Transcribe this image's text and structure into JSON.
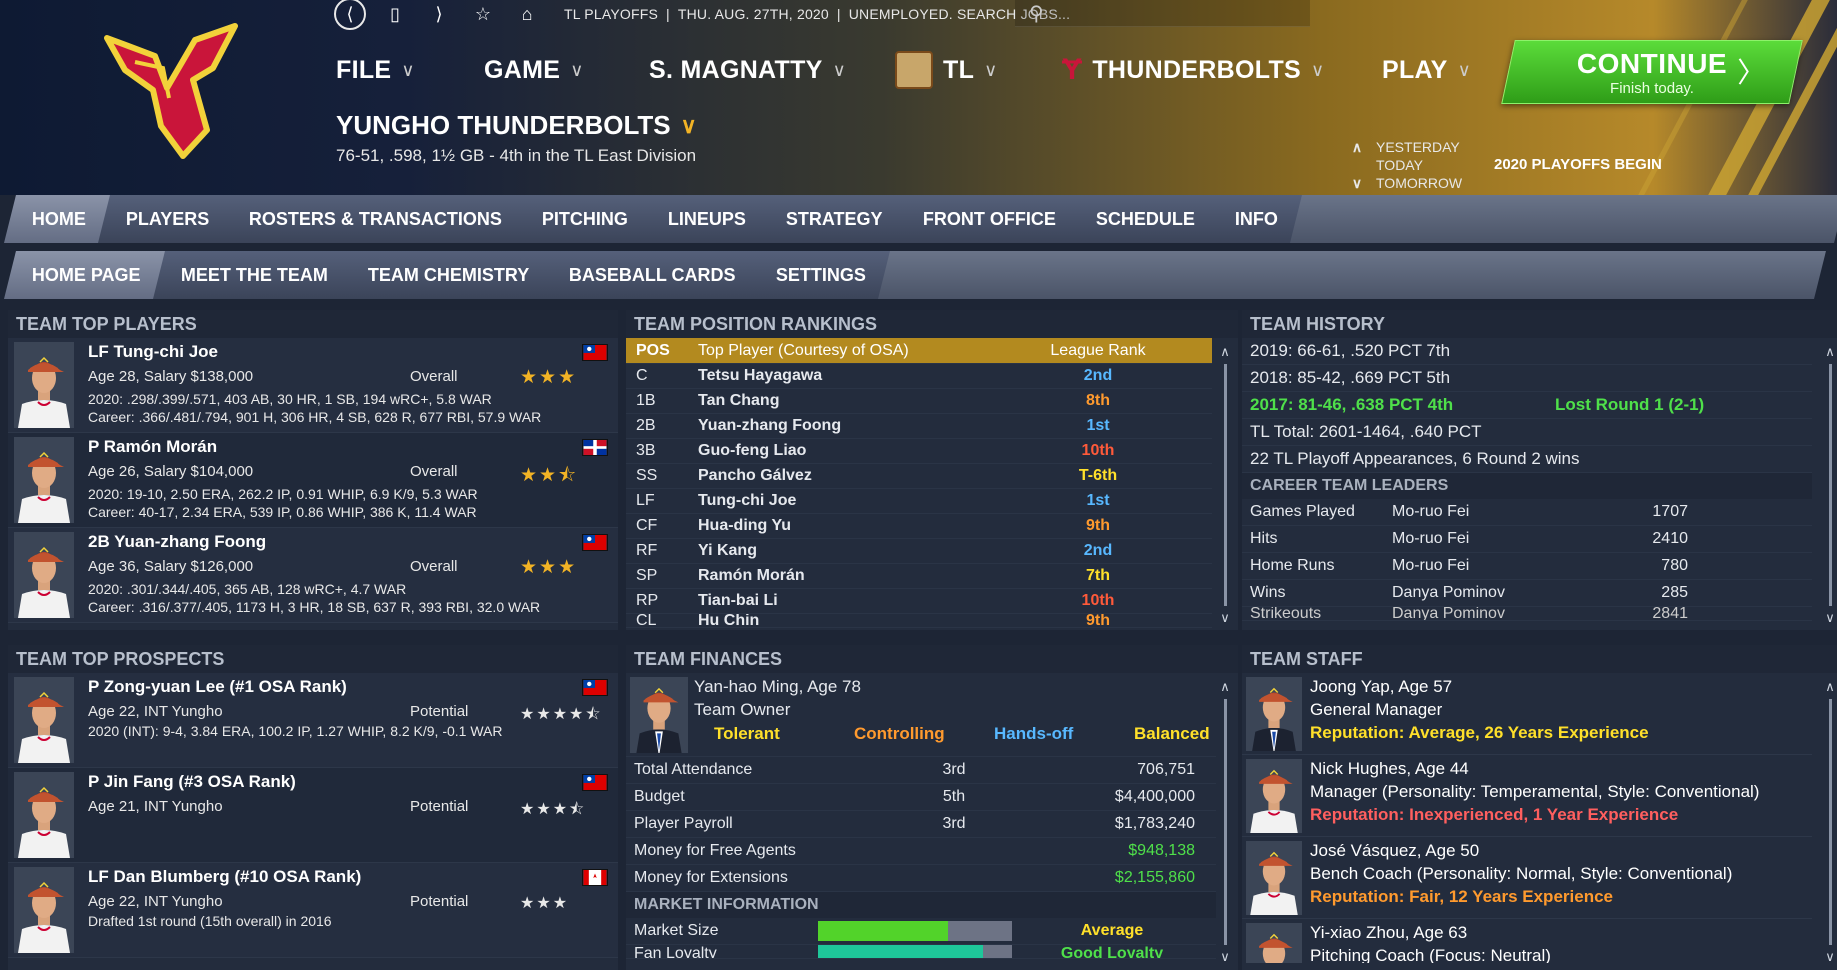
{
  "colors": {
    "accent": "#f2b325",
    "continue": "#3fbf22",
    "rank_blue": "#58b8ff",
    "rank_orange": "#ff9a2e",
    "rank_red": "#ff5a3a",
    "rank_yellow": "#ffe02a",
    "green": "#4fe04a",
    "staff_yellow": "#ffe02a",
    "staff_red": "#ff5f5f",
    "staff_orange": "#ff9a2e"
  },
  "topbar": {
    "status": [
      "TL PLAYOFFS",
      "|",
      "THU. AUG. 27TH, 2020",
      "|",
      "UNEMPLOYED. SEARCH JOBS..."
    ]
  },
  "menu": {
    "file": "FILE",
    "game": "GAME",
    "manager": "S. MAGNATTY",
    "league": "TL",
    "team": "THUNDERBOLTS",
    "play": "PLAY"
  },
  "continue": {
    "label": "CONTINUE",
    "sub": "Finish today."
  },
  "team": {
    "name": "YUNGHO THUNDERBOLTS",
    "record": "76-51, .598, 1½ GB - 4th in the TL East Division"
  },
  "daynav": {
    "yesterday": "YESTERDAY",
    "today": "TODAY",
    "tomorrow": "TOMORROW",
    "note": "2020 PLAYOFFS BEGIN"
  },
  "tabs": [
    "HOME",
    "PLAYERS",
    "ROSTERS & TRANSACTIONS",
    "PITCHING",
    "LINEUPS",
    "STRATEGY",
    "FRONT OFFICE",
    "SCHEDULE",
    "INFO"
  ],
  "subtabs": [
    "HOME PAGE",
    "MEET THE TEAM",
    "TEAM CHEMISTRY",
    "BASEBALL CARDS",
    "SETTINGS"
  ],
  "top_players": {
    "title": "TEAM TOP PLAYERS",
    "items": [
      {
        "name": "LF Tung-chi Joe",
        "info": "Age 28, Salary $138,000",
        "overall_label": "Overall",
        "stars": "★★★",
        "line1": "2020: .298/.399/.571, 403 AB, 30 HR, 1 SB, 194 wRC+, 5.8 WAR",
        "line2": "Career: .366/.481/.794, 901 H, 306 HR, 4 SB, 628 R, 677 RBI, 57.9 WAR",
        "flag": "taiwan"
      },
      {
        "name": "P Ramón Morán",
        "info": "Age 26, Salary $104,000",
        "overall_label": "Overall",
        "stars": "★★⯪",
        "line1": "2020: 19-10, 2.50 ERA, 262.2 IP, 0.91 WHIP, 6.9 K/9, 5.3 WAR",
        "line2": "Career: 40-17, 2.34 ERA, 539 IP, 0.86 WHIP, 386 K, 11.4 WAR",
        "flag": "dominican"
      },
      {
        "name": "2B Yuan-zhang Foong",
        "info": "Age 36, Salary $126,000",
        "overall_label": "Overall",
        "stars": "★★★",
        "line1": "2020: .301/.344/.405, 365 AB, 128 wRC+, 4.7 WAR",
        "line2": "Career: .316/.377/.405, 1173 H, 3 HR, 18 SB, 637 R, 393 RBI, 32.0 WAR",
        "flag": "taiwan"
      }
    ]
  },
  "rankings": {
    "title": "TEAM POSITION RANKINGS",
    "headers": {
      "pos": "POS",
      "player": "Top Player (Courtesy of OSA)",
      "rank": "League Rank"
    },
    "rows": [
      {
        "pos": "C",
        "player": "Tetsu Hayagawa",
        "rank": "2nd",
        "color": "#58b8ff"
      },
      {
        "pos": "1B",
        "player": "Tan Chang",
        "rank": "8th",
        "color": "#ff9a2e"
      },
      {
        "pos": "2B",
        "player": "Yuan-zhang Foong",
        "rank": "1st",
        "color": "#58b8ff"
      },
      {
        "pos": "3B",
        "player": "Guo-feng Liao",
        "rank": "10th",
        "color": "#ff5a3a"
      },
      {
        "pos": "SS",
        "player": "Pancho Gálvez",
        "rank": "T-6th",
        "color": "#ffe02a"
      },
      {
        "pos": "LF",
        "player": "Tung-chi Joe",
        "rank": "1st",
        "color": "#58b8ff"
      },
      {
        "pos": "CF",
        "player": "Hua-ding Yu",
        "rank": "9th",
        "color": "#ff9a2e"
      },
      {
        "pos": "RF",
        "player": "Yi Kang",
        "rank": "2nd",
        "color": "#58b8ff"
      },
      {
        "pos": "SP",
        "player": "Ramón Morán",
        "rank": "7th",
        "color": "#ffe02a"
      },
      {
        "pos": "RP",
        "player": "Tian-bai Li",
        "rank": "10th",
        "color": "#ff5a3a"
      }
    ]
  },
  "history": {
    "title": "TEAM HISTORY",
    "rows": [
      "2019: 66-61, .520 PCT 7th",
      "2018: 85-42, .669 PCT 5th"
    ],
    "highlight": {
      "text": "2017: 81-46, .638 PCT 4th",
      "result": "Lost Round 1 (2-1)"
    },
    "total": "TL Total: 2601-1464, .640 PCT",
    "playoffs": "22 TL Playoff Appearances, 6 Round 2 wins",
    "leaders_title": "CAREER TEAM LEADERS",
    "leaders": [
      {
        "stat": "Games Played",
        "player": "Mo-ruo Fei",
        "value": "1707"
      },
      {
        "stat": "Hits",
        "player": "Mo-ruo Fei",
        "value": "2410"
      },
      {
        "stat": "Home Runs",
        "player": "Mo-ruo Fei",
        "value": "780"
      },
      {
        "stat": "Wins",
        "player": "Danya Pominov",
        "value": "285"
      }
    ]
  },
  "prospects": {
    "title": "TEAM TOP PROSPECTS",
    "items": [
      {
        "name": "P Zong-yuan Lee (#1 OSA Rank)",
        "info": "Age 22, INT Yungho",
        "potential_label": "Potential",
        "stars": "★★★★⯪",
        "line1": "2020 (INT): 9-4, 3.84 ERA, 100.2 IP, 1.27 WHIP, 8.2 K/9, -0.1 WAR",
        "flag": "taiwan"
      },
      {
        "name": "P Jin Fang (#3 OSA Rank)",
        "info": "Age 21, INT Yungho",
        "potential_label": "Potential",
        "stars": "★★★⯪",
        "line1": "",
        "flag": "taiwan"
      },
      {
        "name": "LF Dan Blumberg (#10 OSA Rank)",
        "info": "Age 22, INT Yungho",
        "potential_label": "Potential",
        "stars": "★★★",
        "line1": "Drafted 1st round (15th overall) in 2016",
        "flag": "canada"
      }
    ]
  },
  "finances": {
    "title": "TEAM FINANCES",
    "owner": {
      "name": "Yan-hao Ming, Age 78",
      "role": "Team Owner",
      "traits": [
        {
          "label": "Tolerant",
          "color": "#ffe02a"
        },
        {
          "label": "Controlling",
          "color": "#ff9a2e"
        },
        {
          "label": "Hands-off",
          "color": "#58b8ff"
        },
        {
          "label": "Balanced",
          "color": "#ffe02a"
        }
      ]
    },
    "rows": [
      {
        "label": "Total Attendance",
        "rank": "3rd",
        "value": "706,751",
        "green": false
      },
      {
        "label": "Budget",
        "rank": "5th",
        "value": "$4,400,000",
        "green": false
      },
      {
        "label": "Player Payroll",
        "rank": "3rd",
        "value": "$1,783,240",
        "green": false
      },
      {
        "label": "Money for Free Agents",
        "rank": "",
        "value": "$948,138",
        "green": true
      },
      {
        "label": "Money for Extensions",
        "rank": "",
        "value": "$2,155,860",
        "green": true
      }
    ],
    "market_title": "MARKET INFORMATION",
    "market_size": {
      "label": "Market Size",
      "value": "Average",
      "fill": 0.67
    },
    "fan_loyalty": {
      "label": "Fan Loyalty",
      "value": "Good Loyalty",
      "fill": 0.85
    }
  },
  "staff": {
    "title": "TEAM STAFF",
    "items": [
      {
        "name": "Joong Yap, Age 57",
        "role": "General Manager",
        "rep": "Reputation: Average, 26 Years Experience",
        "color": "#ffe02a",
        "suit": true
      },
      {
        "name": "Nick Hughes, Age 44",
        "role": "Manager (Personality: Temperamental, Style: Conventional)",
        "rep": "Reputation: Inexperienced, 1 Year Experience",
        "color": "#ff5f5f",
        "suit": false
      },
      {
        "name": "José Vásquez, Age 50",
        "role": "Bench Coach (Personality: Normal, Style: Conventional)",
        "rep": "Reputation: Fair, 12 Years Experience",
        "color": "#ff9a2e",
        "suit": false
      },
      {
        "name": "Yi-xiao Zhou, Age 63",
        "role": "Pitching Coach (Focus: Neutral)",
        "rep": "",
        "color": "#ffe02a",
        "suit": false
      }
    ]
  }
}
